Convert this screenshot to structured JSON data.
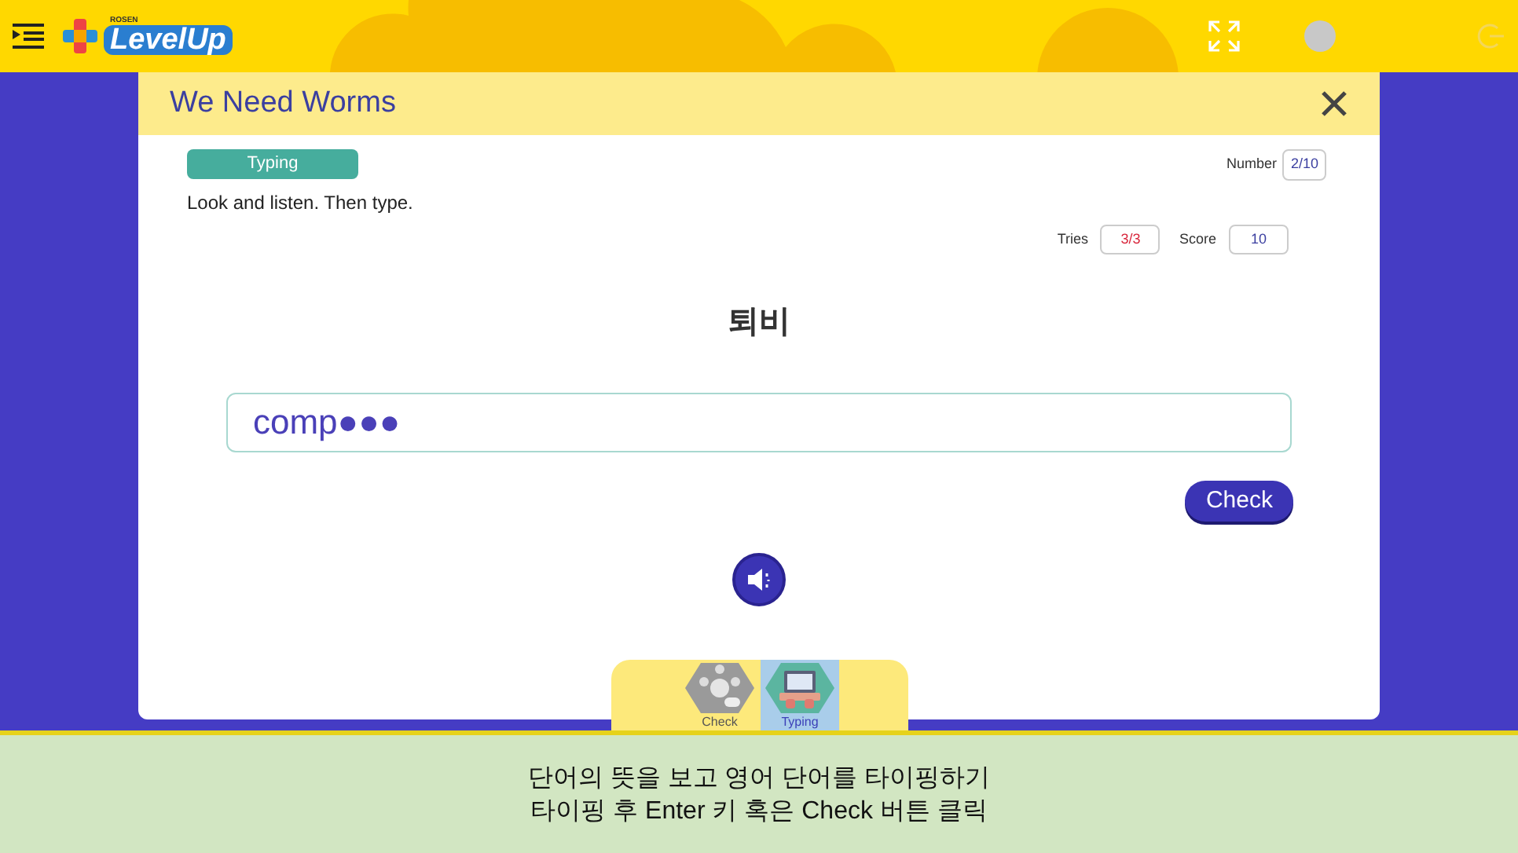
{
  "brand": {
    "small": "ROSEN",
    "name": "LevelUp"
  },
  "activity": {
    "title": "We Need Worms",
    "badge": "Typing",
    "instruction": "Look and listen. Then type.",
    "number_label": "Number",
    "number": "2/10",
    "tries_label": "Tries",
    "tries": "3/3",
    "score_label": "Score",
    "score": "10",
    "prompt": "퇴비",
    "answer": "comp●●●",
    "check_button": "Check"
  },
  "modes": [
    {
      "label": "Check",
      "kind": "quiz",
      "selected": false
    },
    {
      "label": "Typing",
      "kind": "laptop",
      "selected": true
    }
  ],
  "caption": [
    "단어의 뜻을 보고 영어 단어를 타이핑하기",
    "타이핑 후 Enter 키 혹은 Check 버튼 클릭"
  ]
}
